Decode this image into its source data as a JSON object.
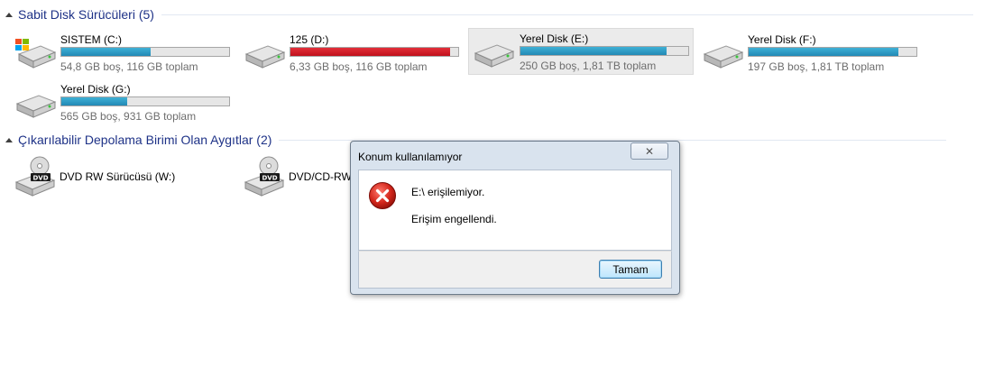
{
  "groups": {
    "hard_drives": {
      "title": "Sabit Disk Sürücüleri (5)"
    },
    "removable": {
      "title": "Çıkarılabilir Depolama Birimi Olan Aygıtlar (2)"
    }
  },
  "drives": [
    {
      "name": "SISTEM (C:)",
      "info": "54,8 GB boş, 116 GB toplam",
      "used_fraction": 0.53,
      "status": "normal",
      "icon": "windows-drive-icon"
    },
    {
      "name": "125 (D:)",
      "info": "6,33 GB boş, 116 GB toplam",
      "used_fraction": 0.95,
      "status": "full",
      "icon": "hard-drive-icon"
    },
    {
      "name": "Yerel Disk (E:)",
      "info": "250 GB boş, 1,81 TB toplam",
      "used_fraction": 0.87,
      "status": "normal",
      "icon": "hard-drive-icon",
      "selected": true
    },
    {
      "name": "Yerel Disk (F:)",
      "info": "197 GB boş, 1,81 TB toplam",
      "used_fraction": 0.89,
      "status": "normal",
      "icon": "hard-drive-icon"
    },
    {
      "name": "Yerel Disk (G:)",
      "info": "565 GB boş, 931 GB toplam",
      "used_fraction": 0.39,
      "status": "normal",
      "icon": "hard-drive-icon"
    }
  ],
  "removable_devices": [
    {
      "name": "DVD RW Sürücüsü (W:)",
      "icon": "dvd-drive-icon",
      "badge": "DVD"
    },
    {
      "name": "DVD/CD-RW",
      "icon": "dvd-drive-icon",
      "badge": "DVD"
    }
  ],
  "dialog": {
    "title": "Konum kullanılamıyor",
    "close_glyph": "✕",
    "message": "E:\\ erişilemiyor.",
    "detail": "Erişim engellendi.",
    "ok_label": "Tamam",
    "icon": "error-icon"
  },
  "colors": {
    "group_title": "#1e3287",
    "bar_normal": "#2289b5",
    "bar_full": "#c0101c",
    "secondary_text": "#6d6d6d"
  }
}
